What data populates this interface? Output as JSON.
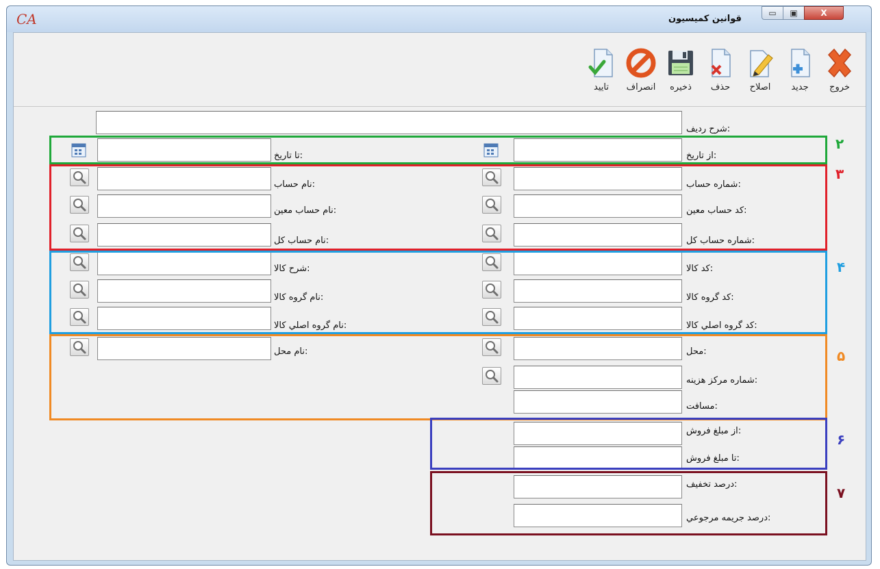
{
  "window": {
    "title": "قوانین کمیسیون",
    "logo": "CA",
    "controls": {
      "minimize": "▭",
      "maximize": "▣",
      "close": "X"
    }
  },
  "toolbar": {
    "exit": "خروج",
    "new": "جديد",
    "edit": "اصلاح",
    "delete": "حذف",
    "save": "ذخيره",
    "cancel": "انصراف",
    "confirm": "تاييد"
  },
  "form": {
    "row_desc": "شرح رديف:",
    "from_date": "از تاريخ:",
    "to_date": "تا تاريخ:",
    "account_number": "شماره حساب:",
    "account_name": "نام حساب:",
    "sub_account_code": "کد حساب معين:",
    "sub_account_name": "نام حساب معين:",
    "general_account_number": "شماره حساب کل:",
    "general_account_name": "نام حساب کل:",
    "item_code": "کد کالا:",
    "item_desc": "شرح کالا:",
    "item_group_code": "کد گروه کالا:",
    "item_group_name": "نام گروه کالا:",
    "item_main_group_code": "کد گروه اصلي کالا:",
    "item_main_group_name": "نام گروه اصلي کالا:",
    "location": "محل:",
    "location_name": "نام محل:",
    "cost_center_number": "شماره مرکز هزينه:",
    "distance": "مسافت:",
    "from_sale_amount": "از مبلغ فروش:",
    "to_sale_amount": "تا مبلغ فروش:",
    "discount_percent": "درصد تخفيف:",
    "return_penalty_percent": "درصد جريمه مرجوعي:"
  },
  "groups": {
    "g2": "۲",
    "g3": "۳",
    "g4": "۴",
    "g5": "۵",
    "g6": "۶",
    "g7": "۷"
  },
  "colors": {
    "g2": "#1fa83a",
    "g3": "#e0202a",
    "g4": "#1f9ee0",
    "g5": "#f08a24",
    "g6": "#3a3fbf",
    "g7": "#7a1020"
  },
  "icons": {
    "exit": "close-x-icon",
    "new": "new-document-icon",
    "edit": "pencil-document-icon",
    "delete": "delete-document-icon",
    "save": "floppy-disk-icon",
    "cancel": "cancel-circle-icon",
    "confirm": "check-document-icon",
    "lookup": "magnifier-icon",
    "calendar": "calendar-icon"
  }
}
